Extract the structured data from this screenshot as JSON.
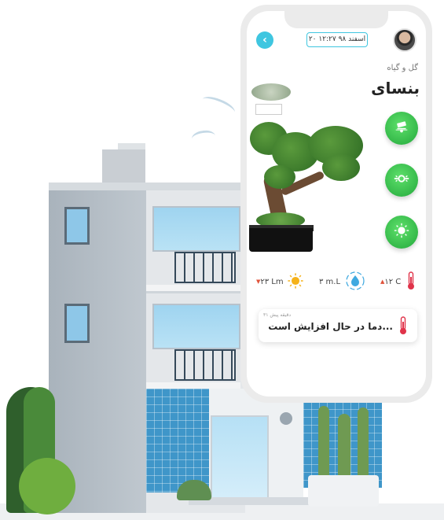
{
  "header": {
    "back_icon": "chevron-left-icon",
    "datetime": "۲۰ اسفند ۹۸  ۱۲:۲۷",
    "avatar_icon": "user-avatar"
  },
  "plant": {
    "category": "گل و گیاه",
    "name": "بنسای"
  },
  "actions": [
    {
      "icon": "camera-icon"
    },
    {
      "icon": "sprinkler-icon"
    },
    {
      "icon": "light-icon"
    }
  ],
  "stats": {
    "temperature": "۱۲ C",
    "water": "۳ m.L",
    "light": "۲۳ Lm"
  },
  "notification": {
    "time": "۳۱ دقیقه پیش",
    "message": "دما در حال افزایش است..."
  },
  "colors": {
    "accent": "#3fc6e0",
    "action_green": "#2db945",
    "thermometer_red": "#e0334a",
    "sun_yellow": "#f5b21a",
    "water_blue": "#3fa9e0"
  }
}
